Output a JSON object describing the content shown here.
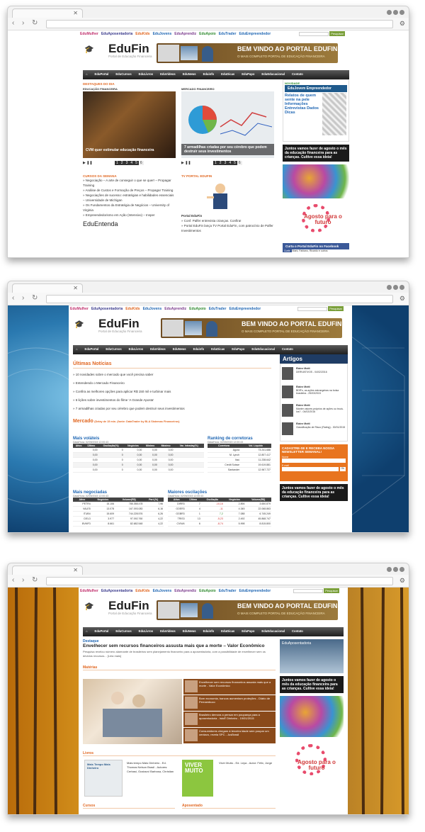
{
  "browser": {
    "close_glyph": "✕",
    "nav_back": "‹",
    "nav_forward": "›",
    "reload": "↻",
    "tools": "⚙"
  },
  "site": {
    "menu": [
      "EduMulher",
      "EduAposentadoria",
      "EduKids",
      "EduJovens",
      "EduAprendiz",
      "EduApoio",
      "EduTrader",
      "EduEmpreendedor"
    ],
    "menu_colors": [
      "#c0306d",
      "#3a3a8c",
      "#e16721",
      "#1f66b3",
      "#7a3a8c",
      "#2f8a2f",
      "#1f66b3",
      "#1f66b3"
    ],
    "search_button": "Pesquisar",
    "logo_name": "EduFin",
    "logo_sub": "Portal de Educação Financeira",
    "banner_title": "BEM VINDO AO PORTAL EDUFIN!",
    "banner_sub": "O MAIS COMPLETO PORTAL DE EDUCAÇÃO FINANCEIRA",
    "nav": [
      "EduPortal",
      "EduCursos",
      "EduLivros",
      "EduVideos",
      "EduNews",
      "Eduinfo",
      "EduDicas",
      "EduPapo",
      "EduEducacional",
      "Contato"
    ]
  },
  "w1": {
    "section": "DESTAQUES DO DIA",
    "left_label": "EDUCAÇÃO FINANCEIRA",
    "right_label": "MERCADO FINANCEIRO",
    "left_caption": "CVM quer estimular educação financeira",
    "right_caption": "7 armadilhas criadas por seu cérebro que podem destruir seus investimentos",
    "pager": [
      "1",
      "2",
      "3",
      "4",
      "5",
      "6"
    ],
    "courses_title": "CURSOS DA SEMANA",
    "courses": [
      "» Negociação – A arte de conseguir o que se quer! – Propagar Training",
      "» Análise de Custos e Formação de Preços – Propagar Training",
      "» Negociações de sucesso: estratégias e habilidades essenciais – Universidade de Michigan",
      "» Os Fundamentos da Estratégia de Negócios – University of Virginia",
      "» Empreendedorismo em Ação (Intensivo) – Insper"
    ],
    "tv_title": "TV PORTAL EDUFIN",
    "tv_sub": "Portal EduFin",
    "tv_items": [
      "» Conf. Palfer entrevista crianças. Confira!",
      "» Portal EduFin lança TV Portal EduFin, com patrocínio de Palfer Investimentos"
    ],
    "more": "EduEntenda",
    "novidade": "NOVIDADE",
    "jovem": "EduJovem Empreendedor",
    "jovem_text": "Relatos de quem sente na pele Informações Entrevistas Dados Dicas",
    "agosto": "Juntos vamos fazer de agosto o mês da educação financeira para as crianças. Cultive essa ideia!",
    "agosto_logo": "Agosto para o futuro",
    "fb": "Curta o Portal EduFin no Facebook",
    "fb_like": "Curtir",
    "fb_text": "Mark, Fabiano, Ricardo e outros"
  },
  "w2": {
    "news_title": "Últimas Notícias",
    "news": [
      "» 10 novidades sobre o mercado que você precisa saber",
      "» Entendendo o Mercado Financeiro",
      "» Confira as melhores opções para aplicar R$ 150 mil e turbinar mais",
      "» 6 lições sobre investimentos do filme 'A Grande Aposta'",
      "» 7 armadilhas criadas por seu cérebro que podem destruir seus investimentos"
    ],
    "mercado": "Mercado",
    "mercado_note": "(Delay de 15 min. (fonte: DataTrader by BLA Sistemas Financeiros)",
    "volateis": "Mais voláteis",
    "dataref": "Data/Hora: 02/09/2015 12:00:43",
    "vol_head": [
      "Ativo",
      "Último",
      "Oscilação(%)",
      "Negócios",
      "Mínimo",
      "Máximo",
      "Var. Intraday(%)"
    ],
    "vol_rows": [
      [
        "",
        "0,00",
        "0",
        "0,00",
        "0,00",
        "0,00"
      ],
      [
        "",
        "0,00",
        "0",
        "0,00",
        "0,00",
        "0,00"
      ],
      [
        "",
        "0,00",
        "0",
        "0,00",
        "0,00",
        "0,00"
      ],
      [
        "",
        "0,00",
        "0",
        "0,00",
        "0,00",
        "0,00"
      ],
      [
        "",
        "0,00",
        "0",
        "0,00",
        "0,00",
        "0,00"
      ]
    ],
    "ranking": "Ranking de corretoras",
    "rank_head": [
      "Corretora",
      "Vol. Líquido"
    ],
    "rank_rows": [
      [
        "Agora",
        "73.241.688"
      ],
      [
        "M. Lynch",
        "12.807.417"
      ],
      [
        "Itaú",
        "11.238.642"
      ],
      [
        "Credit Suisse",
        "19.619.881"
      ],
      [
        "Santander",
        "12.967.727"
      ]
    ],
    "negociadas": "Mais negociadas",
    "neg_head": [
      "Ativo",
      "Negócios",
      "Volume(R$)",
      "Part.(%)"
    ],
    "neg_rows": [
      [
        "PETR4",
        "15.106",
        "785.358.478",
        "7,96"
      ],
      [
        "VALE5",
        "13.078",
        "167.093.083",
        "6,16"
      ],
      [
        "ITUB4",
        "15.609",
        "744.228.576",
        "6,26"
      ],
      [
        "CIEL3",
        "3.977",
        "97.092.760",
        "4,22"
      ],
      [
        "BVMF3",
        "8.661",
        "82.682.548",
        "4,22"
      ]
    ],
    "oscilacoes": "Maiores oscilações",
    "osc_head": [
      "Ativo",
      "Último",
      "Oscilação",
      "Negócios",
      "Volume(R$)"
    ],
    "osc_rows": [
      [
        "DIRR3",
        "7",
        "-10,16",
        "2.894",
        "3.650.879"
      ],
      [
        "GOER3",
        "4",
        "-11",
        "4.345",
        "22.068.863"
      ],
      [
        "GGBR3",
        "1",
        "7,2",
        "7.088",
        "6.745.249"
      ],
      [
        "TRIS3",
        "13",
        "-5,23",
        "2.492",
        "45.868.747"
      ],
      [
        "CVIW4",
        "6",
        "-8,74",
        "5.998",
        "8.815.800"
      ]
    ],
    "artigos": "Artigos",
    "articles": [
      {
        "author": "Elaine Motti",
        "title": "DERIVATIVOS - 04/02/2016"
      },
      {
        "author": "Elaine Motti",
        "title": "BDR's, as ações estrangeiras na bolsa brasileira - 25/03/2015"
      },
      {
        "author": "Elaine Motti",
        "title": "Manter valores próprios de ações ou trocá-los? - 04/02/2016"
      },
      {
        "author": "Elaine Motti",
        "title": "Classificação de Risco (Rating) - 30/01/2015"
      }
    ],
    "newsletter": "CADASTRE-SE E RECEBA NOSSA NEWSLETTER SEMANAL!",
    "nome": "Nome",
    "email": "E-mail",
    "ok": "Ok",
    "agosto": "Juntos vamos fazer de agosto o mês da educação financeira para as crianças. Cultive essa ideia!"
  },
  "w3": {
    "destaque": "Destaque",
    "headline": "Envelhecer sem recursos financeiros assusta mais que a morte – Valor Econômico",
    "summary": "Pesquisa revelou número alarmante de brasileiros sem planejamento financeiro para a aposentadoria, com a possibilidade de envelhecer sem os devidos recursos... [Leia mais]",
    "materias": "Matérias",
    "list": [
      "Envelhecer sem recursos financeiros assusta mais que a morte - Valor Econômico",
      "Bom economia, bancos aumentam proteções - Diário de Pernambuco",
      "Brasileiro demora a pensar em poupança para a aposentadoria - IstoÉ Dinheiro - 19/01/2015",
      "Consumidores chegam à terceira idade sem poupar um centavo, revela SPC - JusBrasil"
    ],
    "livros": "Livros",
    "book1": "Mais tempo Mais Dinheiro - Ed. Thomas Nelson Brasil - Autores: Cerbasi, Gustavo/ Barbosa, Christian",
    "book1_cover": "Mais Tempo Mais Dinheiro",
    "book2": "Viver Muito - Ed. Leya - Autor: Félix, Jorge",
    "book2_cover": "VIVER MUITO",
    "cursos": "Cursos",
    "aposentado": "Aposentado",
    "eduapos": "EduAposentadoria",
    "agosto": "Juntos vamos fazer de agosto o mês da educação financeira para as crianças. Cultive essa ideia!",
    "agosto_logo": "Agosto para o futuro"
  }
}
